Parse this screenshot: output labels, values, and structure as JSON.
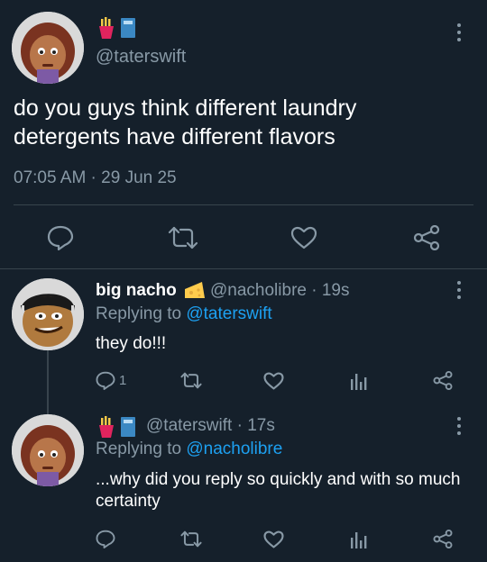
{
  "colors": {
    "background": "#15202b",
    "text_primary": "#ffffff",
    "text_secondary": "#8899a6",
    "link": "#1da1f2",
    "divider": "#38444d"
  },
  "main_tweet": {
    "badges": [
      "fries-emoji",
      "blue-book-emoji"
    ],
    "handle": "@taterswift",
    "text": "do you guys think different laundry detergents have different flavors",
    "timestamp": "07:05 AM · 29 Jun 25",
    "actions": [
      "reply-icon",
      "retweet-icon",
      "like-icon",
      "share-icon"
    ]
  },
  "replies": [
    {
      "display_name": "big nacho",
      "badge": "cheese-emoji",
      "handle_time": "@nacholibre · 19s",
      "replying_prefix": "Replying to ",
      "replying_to": "@taterswift",
      "text": "they do!!!",
      "reply_count": "1",
      "actions": [
        "reply-icon",
        "retweet-icon",
        "like-icon",
        "analytics-icon",
        "share-icon"
      ]
    },
    {
      "badges": [
        "fries-emoji",
        "blue-book-emoji"
      ],
      "handle_time": "@taterswift · 17s",
      "replying_prefix": "Replying to ",
      "replying_to": "@nacholibre",
      "text": "...why did you reply so quickly and with so much certainty",
      "actions": [
        "reply-icon",
        "retweet-icon",
        "like-icon",
        "analytics-icon",
        "share-icon"
      ]
    }
  ]
}
